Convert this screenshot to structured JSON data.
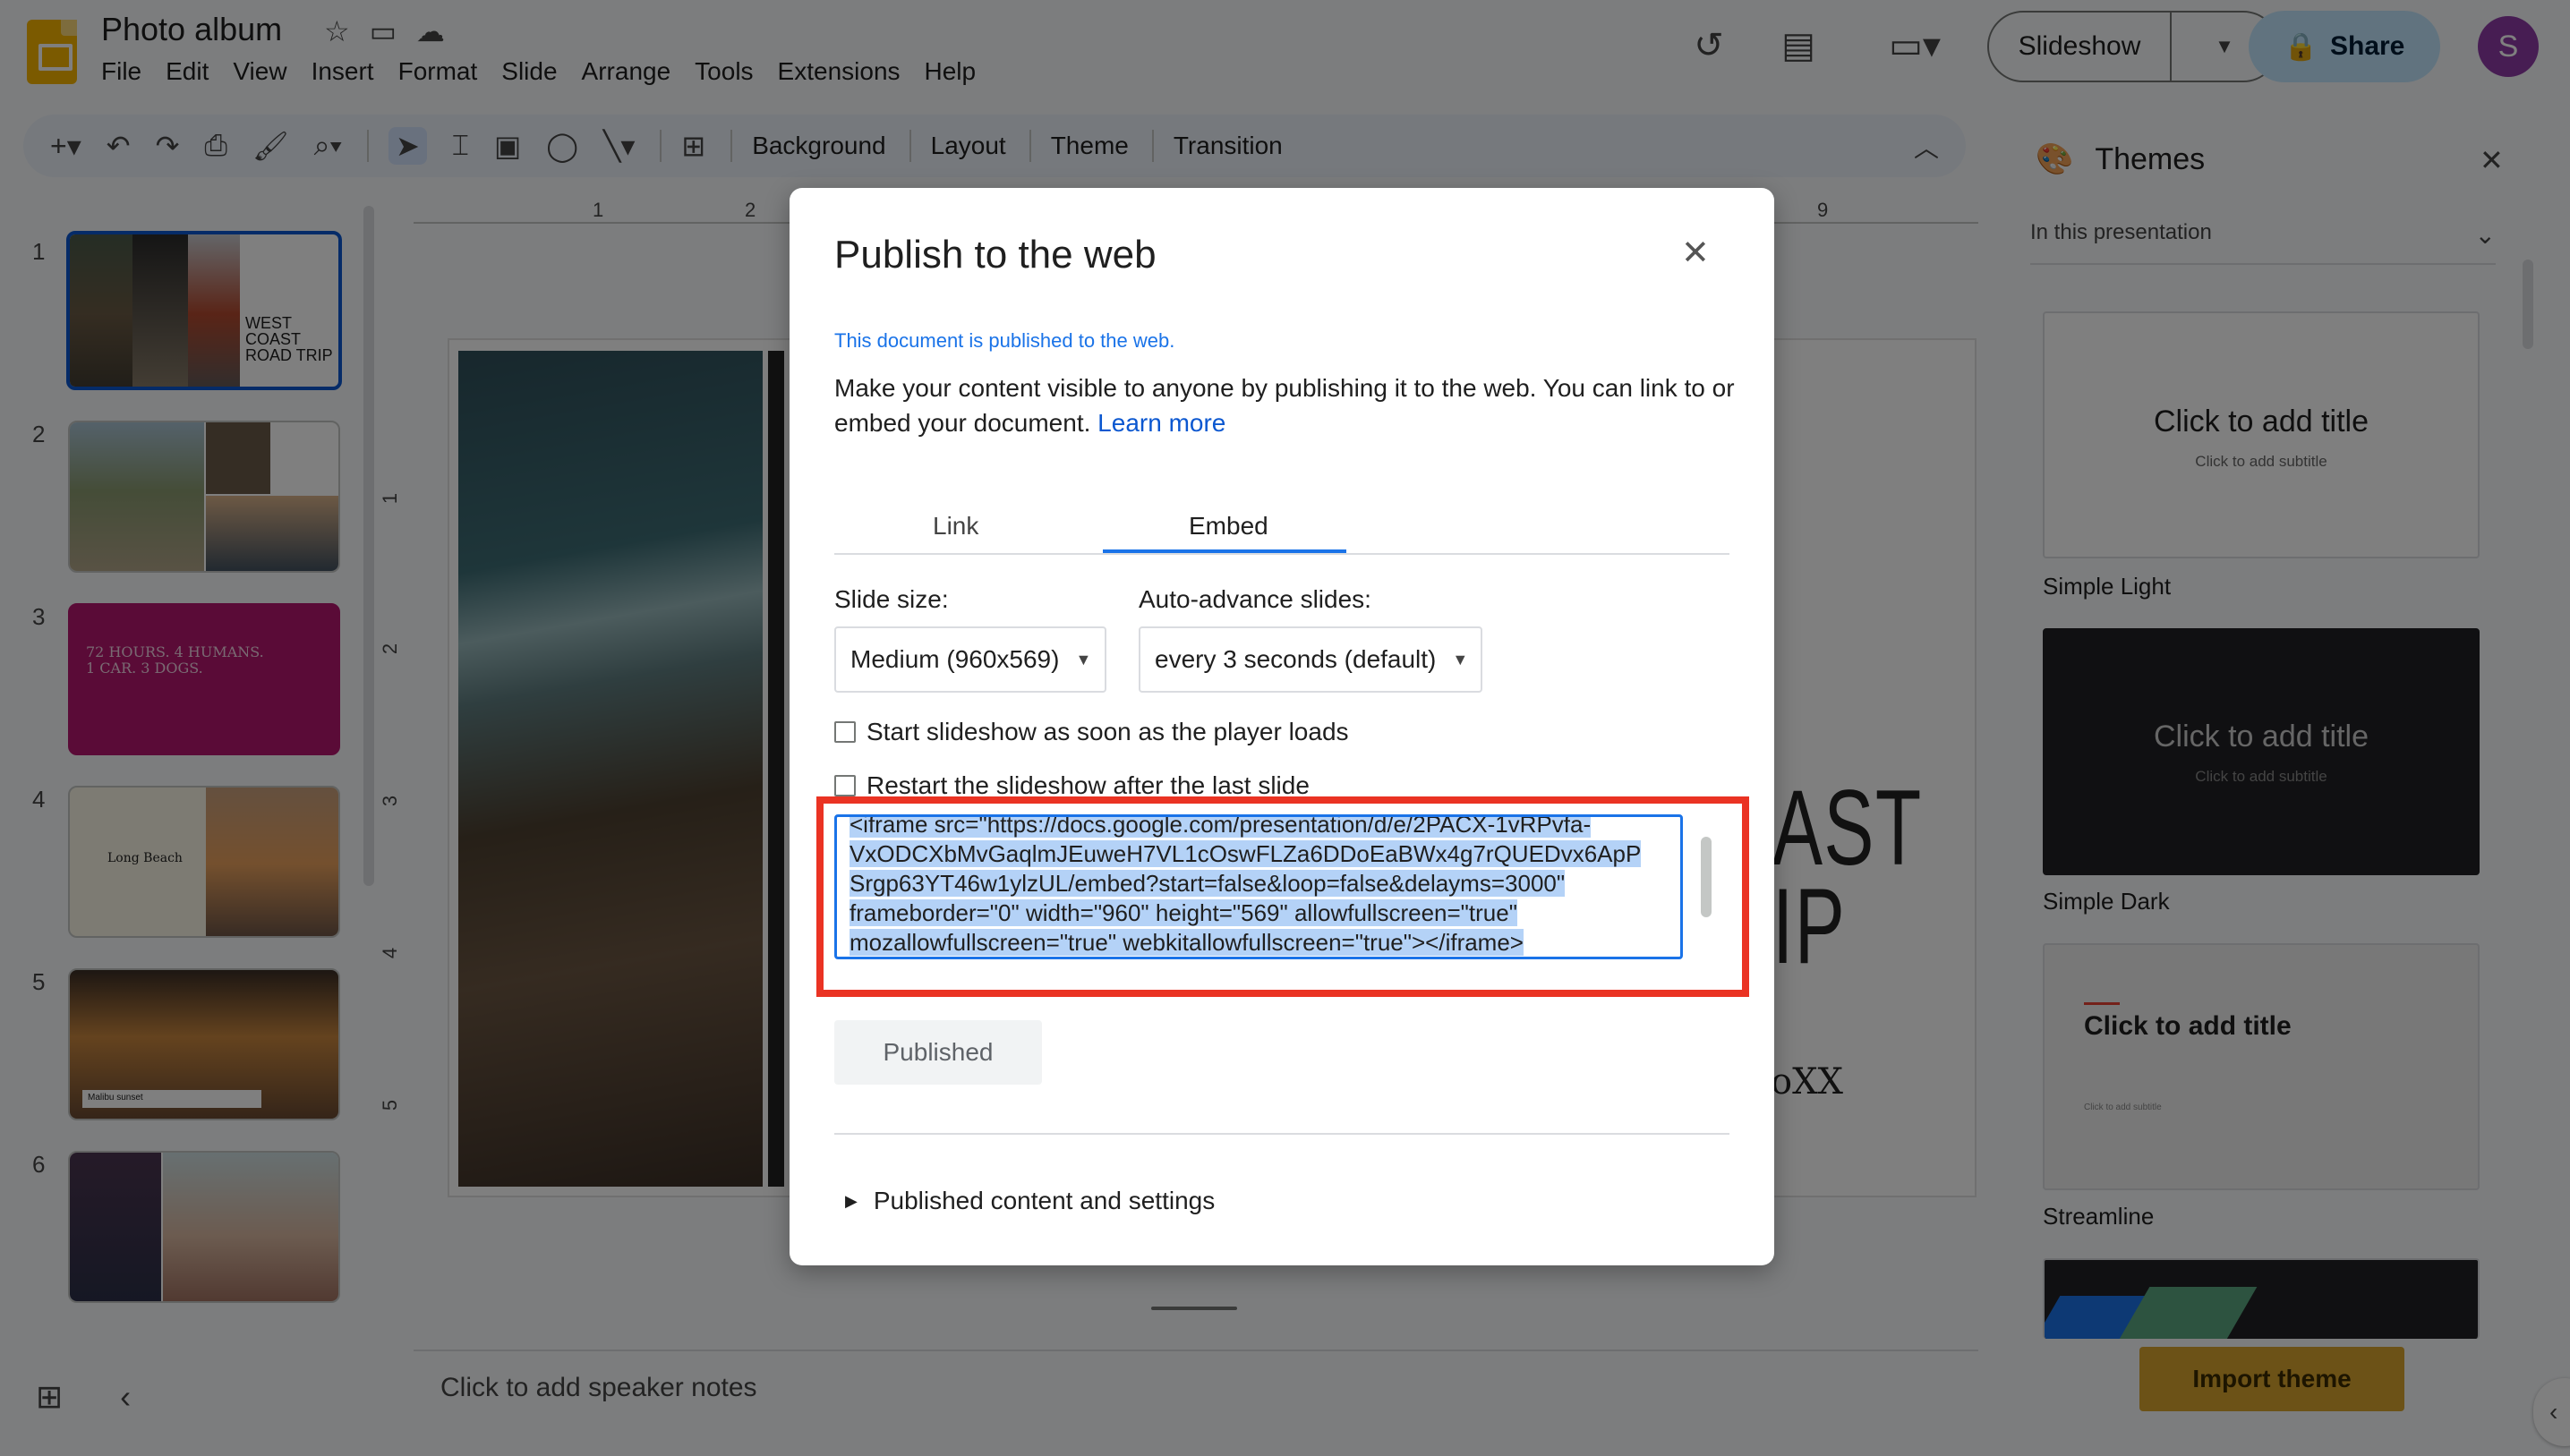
{
  "header": {
    "doc_title": "Photo album",
    "menu": [
      "File",
      "Edit",
      "View",
      "Insert",
      "Format",
      "Slide",
      "Arrange",
      "Tools",
      "Extensions",
      "Help"
    ],
    "slideshow_label": "Slideshow",
    "share_label": "Share",
    "avatar_initial": "S"
  },
  "toolbar": {
    "background_label": "Background",
    "layout_label": "Layout",
    "theme_label": "Theme",
    "transition_label": "Transition"
  },
  "filmstrip": {
    "slides": [
      {
        "num": "1",
        "text": "WEST COAST ROAD TRIP"
      },
      {
        "num": "2",
        "text": ""
      },
      {
        "num": "3",
        "text": "72 HOURS. 4 HUMANS. 1 CAR. 3 DOGS."
      },
      {
        "num": "4",
        "text": "Long Beach"
      },
      {
        "num": "5",
        "text": "Malibu sunset"
      },
      {
        "num": "6",
        "text": ""
      }
    ]
  },
  "ruler": {
    "h_ticks": [
      "1",
      "2",
      "9"
    ],
    "v_ticks": [
      "1",
      "2",
      "3",
      "4",
      "5"
    ]
  },
  "canvas": {
    "title_line1": "AST",
    "title_line2": "IP",
    "subtitle": "oXX",
    "speaker_notes_placeholder": "Click to add speaker notes"
  },
  "themes_panel": {
    "title": "Themes",
    "filter": "In this presentation",
    "themes": [
      {
        "name": "Simple Light",
        "title": "Click to add title",
        "subtitle": "Click to add subtitle"
      },
      {
        "name": "Simple Dark",
        "title": "Click to add title",
        "subtitle": "Click to add subtitle"
      },
      {
        "name": "Streamline",
        "title": "Click to add title",
        "subtitle": "Click to add subtitle"
      }
    ],
    "import_label": "Import theme"
  },
  "dialog": {
    "title": "Publish to the web",
    "status": "This document is published to the web.",
    "description": "Make your content visible to anyone by publishing it to the web. You can link to or embed your document.",
    "learn_more": "Learn more",
    "tabs": [
      "Link",
      "Embed"
    ],
    "active_tab": "Embed",
    "slide_size_label": "Slide size:",
    "slide_size_value": "Medium (960x569)",
    "auto_advance_label": "Auto-advance slides:",
    "auto_advance_value": "every 3 seconds (default)",
    "start_on_load_label": "Start slideshow as soon as the player loads",
    "restart_label": "Restart the slideshow after the last slide",
    "embed_code_lines": [
      "<iframe src=\"https://docs.google.com/presentation/d/e/2PACX-1vRPvfa-",
      "VxODCXbMvGaqlmJEuweH7VL1cOswFLZa6DDoEaBWx4g7rQUEDvx6ApP",
      "Srgp63YT46w1ylzUL/embed?start=false&loop=false&delayms=3000\"",
      "frameborder=\"0\" width=\"960\" height=\"569\" allowfullscreen=\"true\"",
      "mozallowfullscreen=\"true\" webkitallowfullscreen=\"true\"></iframe>"
    ],
    "published_label": "Published",
    "settings_label": "Published content and settings"
  },
  "colors": {
    "accent": "#1a73e8",
    "highlight": "#ea3323",
    "slide3_bg": "#b5166f",
    "import_btn": "#d9a52e"
  }
}
